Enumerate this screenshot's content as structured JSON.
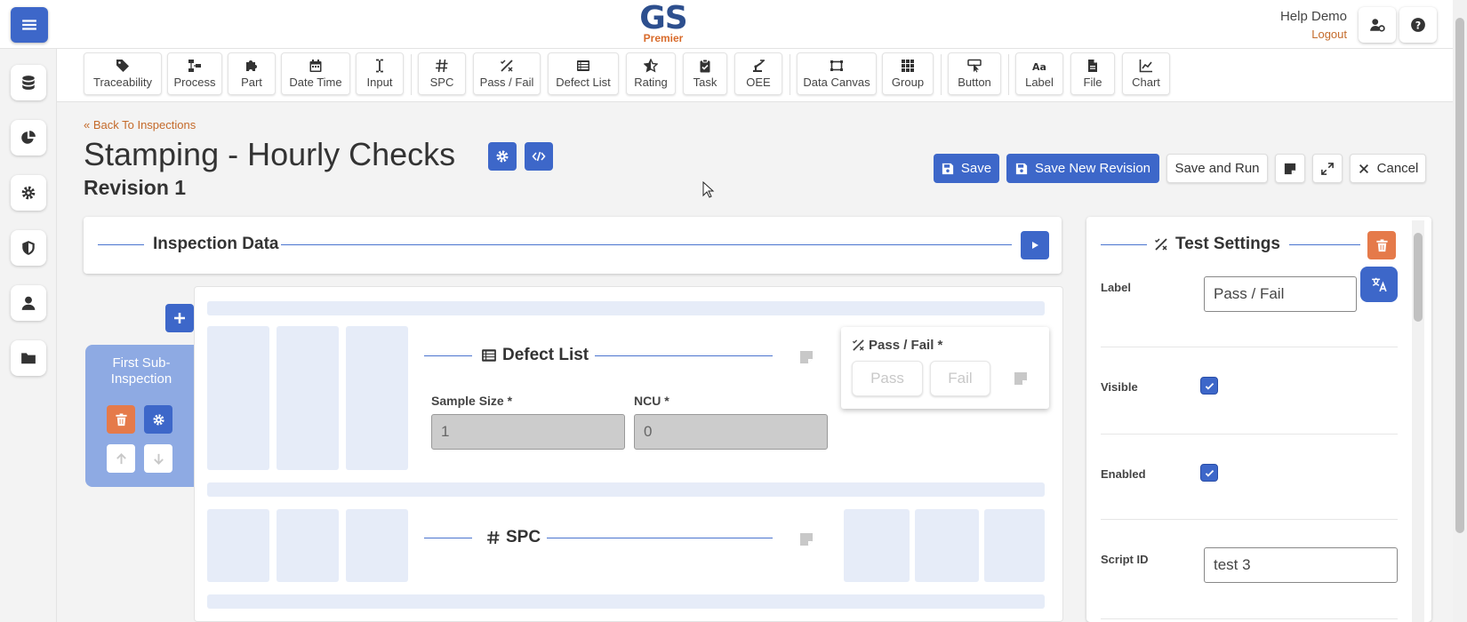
{
  "header": {
    "logo_main": "GS",
    "logo_sub": "Premier",
    "user_name": "Help Demo",
    "logout_label": "Logout"
  },
  "toolbar": {
    "items": [
      {
        "label": "Traceability",
        "icon": "tag-icon"
      },
      {
        "label": "Process",
        "icon": "process-icon"
      },
      {
        "label": "Part",
        "icon": "puzzle-icon"
      },
      {
        "label": "Date Time",
        "icon": "calendar-icon"
      },
      {
        "label": "Input",
        "icon": "text-cursor-icon"
      },
      {
        "label": "SPC",
        "icon": "hash-icon"
      },
      {
        "label": "Pass / Fail",
        "icon": "percent-icon"
      },
      {
        "label": "Defect List",
        "icon": "list-icon"
      },
      {
        "label": "Rating",
        "icon": "star-icon"
      },
      {
        "label": "Task",
        "icon": "clipboard-check-icon"
      },
      {
        "label": "OEE",
        "icon": "robot-arm-icon"
      },
      {
        "label": "Data Canvas",
        "icon": "canvas-icon"
      },
      {
        "label": "Group",
        "icon": "grid-icon"
      },
      {
        "label": "Button",
        "icon": "pointer-button-icon"
      },
      {
        "label": "Label",
        "icon": "font-icon"
      },
      {
        "label": "File",
        "icon": "file-icon"
      },
      {
        "label": "Chart",
        "icon": "chart-icon"
      }
    ]
  },
  "page": {
    "back_link": "Back To Inspections",
    "title": "Stamping - Hourly Checks",
    "revision": "Revision 1"
  },
  "actions": {
    "save": "Save",
    "save_new_revision": "Save New Revision",
    "save_and_run": "Save and Run",
    "cancel": "Cancel"
  },
  "inspection_data": {
    "title": "Inspection Data"
  },
  "sub_inspection": {
    "title": "First Sub-Inspection"
  },
  "defect_list": {
    "title": "Defect List",
    "sample_size_label": "Sample Size *",
    "sample_size_value": "1",
    "ncu_label": "NCU *",
    "ncu_value": "0"
  },
  "pass_fail": {
    "title": "Pass / Fail *",
    "pass_label": "Pass",
    "fail_label": "Fail"
  },
  "spc": {
    "title": "SPC"
  },
  "test_settings": {
    "title": "Test Settings",
    "label_label": "Label",
    "label_value": "Pass / Fail",
    "visible_label": "Visible",
    "enabled_label": "Enabled",
    "script_id_label": "Script ID",
    "script_id_value": "test 3"
  },
  "colors": {
    "primary": "#3d67c9",
    "danger": "#e57a4a",
    "link": "#c46a2a",
    "placeholder": "#e6ecf8",
    "sub_card": "#8eaae3"
  }
}
